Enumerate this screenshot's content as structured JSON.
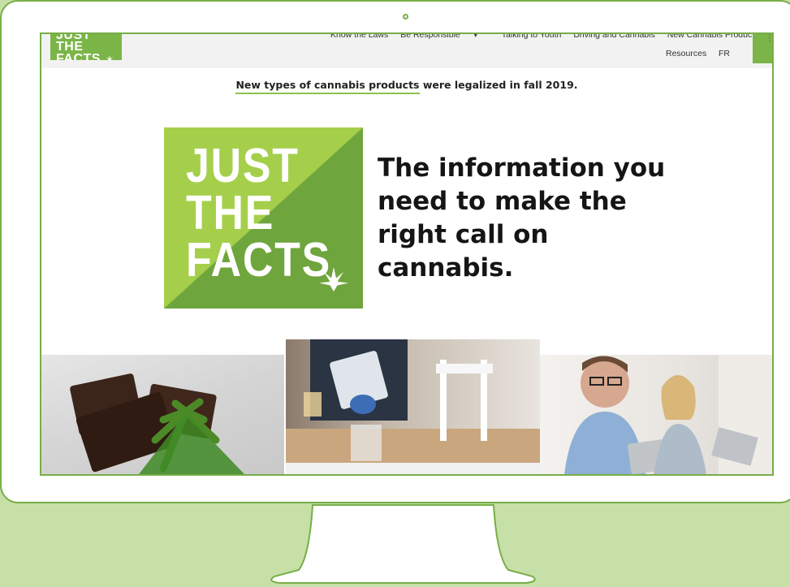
{
  "nav": {
    "logo_line1": "JUST THE",
    "logo_line2": "FACTS",
    "items": [
      "Know the Laws",
      "Be Responsible",
      "Talking to Youth",
      "Driving and Cannabis",
      "New Cannabis Products"
    ],
    "resources": "Resources",
    "language": "FR"
  },
  "banner": {
    "highlight": "New types of cannabis products",
    "rest": " were legalized in fall 2019."
  },
  "hero": {
    "logo_lines": [
      "JUST",
      "THE",
      "FACTS"
    ],
    "headline": "The information you need to make the right call on cannabis."
  },
  "colors": {
    "brand_green": "#7bb548",
    "light_green": "#a5cf4b",
    "background": "#c6e0a8"
  },
  "icons": [
    "cannabis-leaf-icon",
    "caret-down-icon",
    "menu-icon"
  ]
}
